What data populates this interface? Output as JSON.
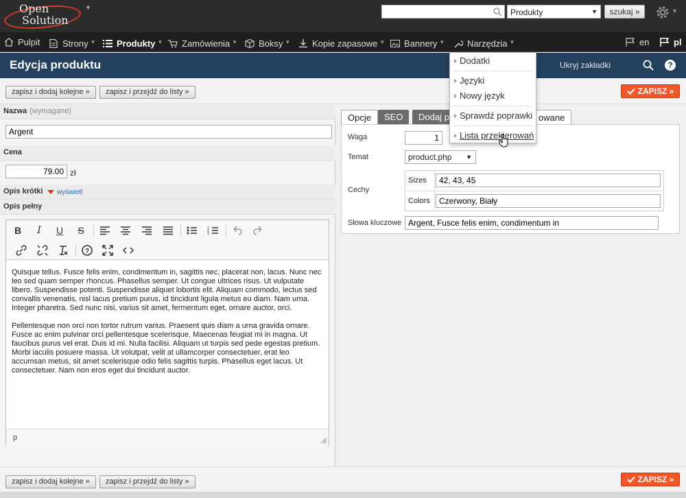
{
  "logo": {
    "line1": "Open",
    "line2": "Solution"
  },
  "search": {
    "value": "",
    "select_value": "Produkty",
    "button_label": "szukaj »"
  },
  "nav": {
    "items": [
      {
        "label": "Pulpit"
      },
      {
        "label": "Strony"
      },
      {
        "label": "Produkty"
      },
      {
        "label": "Zamówienia"
      },
      {
        "label": "Boksy"
      },
      {
        "label": "Kopie zapasowe"
      },
      {
        "label": "Bannery"
      },
      {
        "label": "Narzędzia"
      }
    ],
    "lang_en": "en",
    "lang_pl": "pl"
  },
  "titlebar": {
    "title": "Edycja produktu",
    "hide_tabs": "Ukryj zakładki",
    "help": "?"
  },
  "actions": {
    "save_add_next": "zapisz i dodaj kolejne »",
    "save_go_list": "zapisz i przejdź do listy »",
    "save": "ZAPISZ »"
  },
  "form": {
    "name_label": "Nazwa",
    "name_required": "(wymagane)",
    "name_value": "Argent",
    "price_label": "Cena",
    "price_value": "79.00",
    "price_unit": "zł",
    "short_desc_label": "Opis krótki",
    "short_desc_toggle": "wyświetl",
    "full_desc_label": "Opis pełny"
  },
  "editor": {
    "paragraphs": [
      "Quisque tellus. Fusce felis enim, condimentum in, sagittis nec, placerat non, lacus. Nunc nec leo sed quam semper rhoncus. Phasellus semper. Ut congue ultrices risus. Ut vulputate libero. Suspendisse potenti. Suspendisse aliquet lobortis elit. Aliquam commodo, lectus sed convallis venenatis, nisl lacus pretium purus, id tincidunt ligula metus eu diam. Nam urna. Integer pharetra. Sed nunc nisi, varius sit amet, fermentum eget, ornare auctor, orci.",
      "Pellentesque non orci non tortor rutrum varius. Praesent quis diam a urna gravida ornare. Fusce ac enim pulvinar orci pellentesque scelerisque. Maecenas feugiat mi in magna. Ut faucibus purus vel erat. Duis id mi. Nulla facilisi. Aliquam ut turpis sed pede egestas pretium. Morbi iaculis posuere massa. Ut volutpat, velit at ullamcorper consectetuer, erat leo accumsan metus, sit amet scelerisque odio felis sagittis turpis. Phasellus eget lacus. Ut consectetuer. Nam non eros eget dui tincidunt auctor."
    ],
    "status_path": "p"
  },
  "tabs": [
    {
      "label": "Opcje"
    },
    {
      "label": "SEO"
    },
    {
      "label": "Dodaj pl"
    },
    {
      "label": "owane"
    }
  ],
  "options": {
    "weight_label": "Waga",
    "weight_value": "1",
    "theme_label": "Temat",
    "theme_value": "product.php",
    "features_label": "Cechy",
    "sizes_label": "Sizes",
    "sizes_value": "42, 43, 45",
    "colors_label": "Colors",
    "colors_value": "Czerwony, Biały",
    "keywords_label": "Słowa kluczowe",
    "keywords_value": "Argent, Fusce felis enim, condimentum in"
  },
  "dropdown": {
    "items": [
      {
        "label": "Dodatki"
      },
      {
        "label": "Języki"
      },
      {
        "label": "Nowy język"
      },
      {
        "label": "Sprawdź poprawki"
      },
      {
        "label": "Lista przekierowań"
      }
    ]
  },
  "colors": {
    "accent": "#f2572a",
    "titlebar": "#23405e",
    "topbar": "#2c2c2c"
  }
}
